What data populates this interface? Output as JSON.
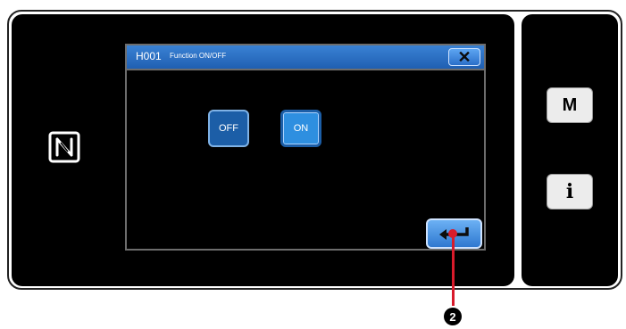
{
  "dialog": {
    "code": "H001",
    "title": "Function ON/OFF",
    "close_label": "✕"
  },
  "toggle": {
    "off_label": "OFF",
    "on_label": "ON",
    "selected": "ON"
  },
  "side_panel": {
    "menu_label": "M",
    "info_label": "i"
  },
  "callout": {
    "marker": "2"
  },
  "icons": [
    "nfc-icon",
    "close-icon",
    "enter-icon"
  ],
  "colors": {
    "titlebar": "#2a6fc4",
    "button_on": "#2e8fe0",
    "button_off": "#1c5ea7",
    "callout": "#d81b2b"
  }
}
